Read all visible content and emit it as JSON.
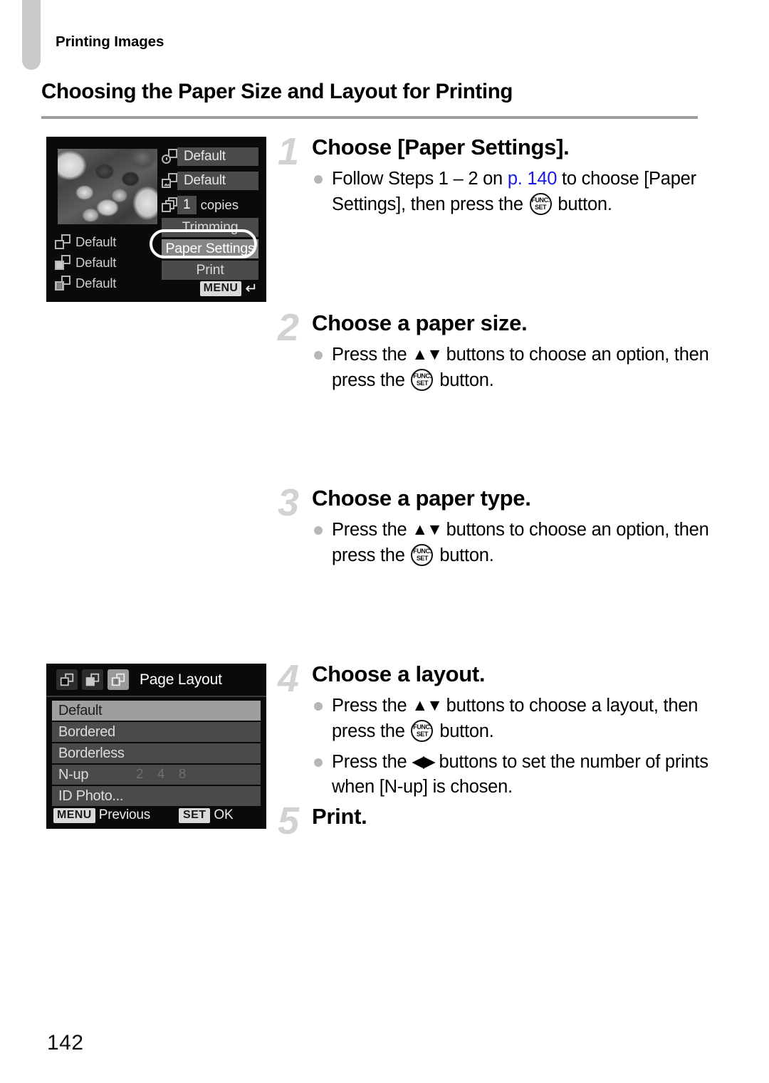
{
  "header": {
    "running_title": "Printing Images",
    "page_title": "Choosing the Paper Size and Layout for Printing",
    "page_number": "142"
  },
  "screens": {
    "print_settings": {
      "name": "print-settings-screen",
      "value_rows": [
        {
          "icon": "date-icon",
          "value": "Default"
        },
        {
          "icon": "file-number-icon",
          "value": "Default"
        }
      ],
      "copies": {
        "icon": "copies-icon",
        "count": "1",
        "label": "copies"
      },
      "menu_items": [
        {
          "label": "Trimming",
          "selected": false
        },
        {
          "label": "Paper Settings",
          "selected": true
        },
        {
          "label": "Print",
          "selected": false
        }
      ],
      "left_rows": [
        {
          "icon": "paper-size-icon",
          "label": "Default"
        },
        {
          "icon": "paper-type-icon",
          "label": "Default"
        },
        {
          "icon": "page-layout-icon",
          "label": "Default"
        }
      ],
      "footer": {
        "badge": "MENU",
        "arrow": "↵"
      }
    },
    "page_layout": {
      "name": "page-layout-screen",
      "tabs": [
        {
          "icon": "paper-size-icon",
          "active": false
        },
        {
          "icon": "paper-type-icon",
          "active": false
        },
        {
          "icon": "page-layout-icon",
          "active": true
        }
      ],
      "title": "Page Layout",
      "options": [
        {
          "label": "Default",
          "selected": true,
          "values": ""
        },
        {
          "label": "Bordered",
          "selected": false,
          "values": ""
        },
        {
          "label": "Borderless",
          "selected": false,
          "values": ""
        },
        {
          "label": "N-up",
          "selected": false,
          "values": "2 4 8"
        },
        {
          "label": "ID Photo...",
          "selected": false,
          "values": ""
        }
      ],
      "footer": {
        "menu_badge": "MENU",
        "menu_label": "Previous",
        "set_badge": "SET",
        "set_label": "OK"
      }
    }
  },
  "steps": [
    {
      "number": "1",
      "title": "Choose [Paper Settings].",
      "bullets": [
        {
          "pre": "Follow Steps 1 – 2 on ",
          "link": "p. 140",
          "mid": " to choose [Paper Settings], then press the ",
          "post": " button."
        }
      ]
    },
    {
      "number": "2",
      "title": "Choose a paper size.",
      "bullets": [
        {
          "pre": "Press the ",
          "dpad": "▲▼",
          "mid": " buttons to choose an option, then press the ",
          "post": " button."
        }
      ]
    },
    {
      "number": "3",
      "title": "Choose a paper type.",
      "bullets": [
        {
          "pre": "Press the ",
          "dpad": "▲▼",
          "mid": " buttons to choose an option, then press the ",
          "post": " button."
        }
      ]
    },
    {
      "number": "4",
      "title": "Choose a layout.",
      "bullets": [
        {
          "pre": "Press the ",
          "dpad": "▲▼",
          "mid": " buttons to choose a layout, then press the ",
          "post": " button."
        },
        {
          "pre": "Press the ",
          "dpad": "◀▶",
          "mid": " buttons to set the number of prints when [N-up] is chosen.",
          "post": ""
        }
      ]
    },
    {
      "number": "5",
      "title": "Print.",
      "bullets": []
    }
  ],
  "glyphs": {
    "funcset_top": "FUNC.",
    "funcset_bottom": "SET"
  },
  "colors": {
    "link": "#1a1ae8",
    "step_number": "#d2d2d2",
    "rule": "#9d9d9d",
    "tab": "#c9c9c9"
  }
}
